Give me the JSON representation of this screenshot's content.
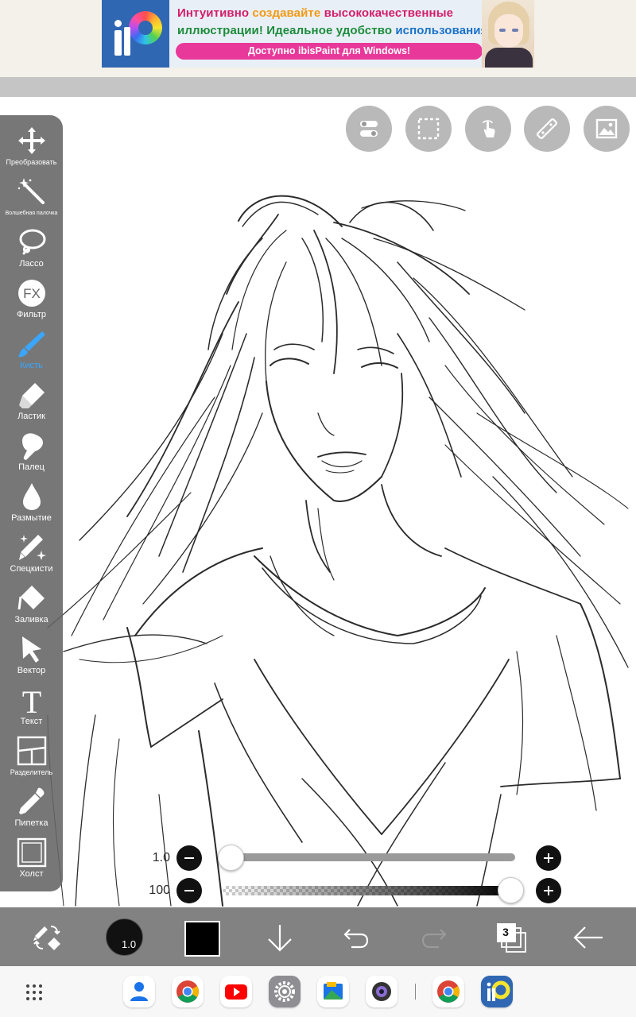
{
  "ad": {
    "line1_part1": "Интуитивно ",
    "line1_part2": "создавайте ",
    "line1_part3": "высококачественные",
    "line2_part1": "иллюстрации! ",
    "line2_part2": "Идеальное удобство ",
    "line2_part3": "использования!",
    "cta": "Доступно ibisPaint для Windows!",
    "colors": {
      "pink": "#d31e6a",
      "orange": "#f29a14",
      "green": "#1c8c3a",
      "blue": "#1b72c9",
      "cta_bg": "#e8399a"
    }
  },
  "tools": [
    {
      "id": "transform",
      "label": "Преобразовать",
      "icon": "move-arrows-icon"
    },
    {
      "id": "magic-wand",
      "label": "Волшебная палочка",
      "icon": "magic-wand-icon"
    },
    {
      "id": "lasso",
      "label": "Лассо",
      "icon": "lasso-icon"
    },
    {
      "id": "filter",
      "label": "Фильтр",
      "icon": "fx-icon"
    },
    {
      "id": "brush",
      "label": "Кисть",
      "icon": "brush-icon",
      "active": true
    },
    {
      "id": "eraser",
      "label": "Ластик",
      "icon": "eraser-icon"
    },
    {
      "id": "smudge",
      "label": "Палец",
      "icon": "finger-icon"
    },
    {
      "id": "blur",
      "label": "Размытие",
      "icon": "drop-icon"
    },
    {
      "id": "special-brush",
      "label": "Спецкисти",
      "icon": "sparkle-brush-icon"
    },
    {
      "id": "fill",
      "label": "Заливка",
      "icon": "fill-bucket-icon"
    },
    {
      "id": "vector",
      "label": "Вектор",
      "icon": "cursor-arrow-icon"
    },
    {
      "id": "text",
      "label": "Текст",
      "icon": "text-t-icon"
    },
    {
      "id": "frame-divider",
      "label": "Разделитель",
      "icon": "panel-divider-icon"
    },
    {
      "id": "eyedropper",
      "label": "Пипетка",
      "icon": "eyedropper-icon"
    },
    {
      "id": "canvas",
      "label": "Холст",
      "icon": "canvas-square-icon"
    }
  ],
  "top_buttons": [
    "toggle-settings-icon",
    "selection-icon",
    "touch-gesture-icon",
    "ruler-icon",
    "reference-image-icon"
  ],
  "sliders": {
    "size": {
      "label": "1.0",
      "value": 1.0,
      "fraction": 0.0
    },
    "opacity": {
      "label": "100",
      "value": 100,
      "fraction": 1.0
    }
  },
  "bottom_toolbar": {
    "brush_size": "1.0",
    "current_color": "#000000",
    "layer_count": "3"
  },
  "dock": {
    "apps": [
      "contacts-icon",
      "chrome-icon",
      "youtube-icon",
      "settings-icon",
      "files-icon",
      "camera-icon",
      "chrome-icon",
      "ibispaint-icon"
    ]
  }
}
